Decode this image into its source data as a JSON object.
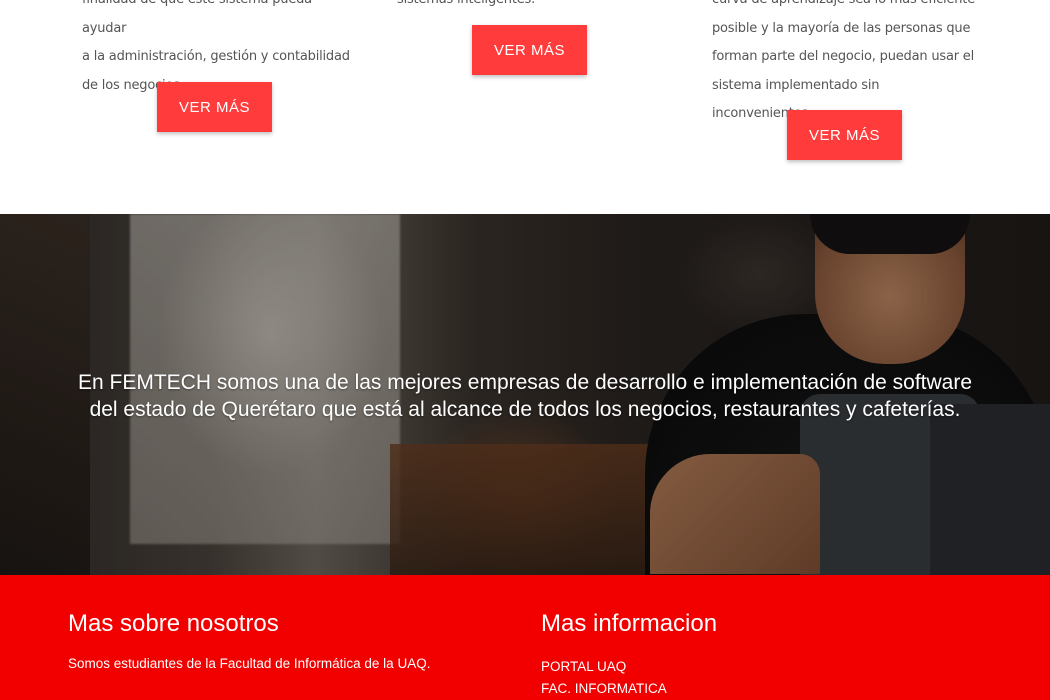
{
  "services": {
    "col1_lines": [
      "finalidad de que este sistema pueda ayudar",
      "a la administración, gestión y contabilidad",
      "de los negocios."
    ],
    "col2_lines": [
      "sistemas inteligentes."
    ],
    "col3_lines": [
      "curva de aprendizaje sea lo más eficiente",
      "posible y la mayoría de las personas que",
      "forman parte del negocio, puedan usar el",
      "sistema implementado sin inconvenientes."
    ],
    "button_label": "VER MÁS"
  },
  "hero": {
    "line1": "En FEMTECH somos una de las mejores empresas de desarrollo e implementación de software",
    "line2": "del estado de Querétaro que está al alcance de todos los negocios, restaurantes y cafeterías."
  },
  "footer": {
    "about_title": "Mas sobre nosotros",
    "about_text": "Somos estudiantes de la Facultad de Informática de la UAQ.",
    "info_title": "Mas informacion",
    "links": [
      "PORTAL UAQ",
      "FAC. INFORMATICA"
    ]
  },
  "colors": {
    "accent": "#ff3b3b",
    "footer_bg": "#f20000"
  }
}
